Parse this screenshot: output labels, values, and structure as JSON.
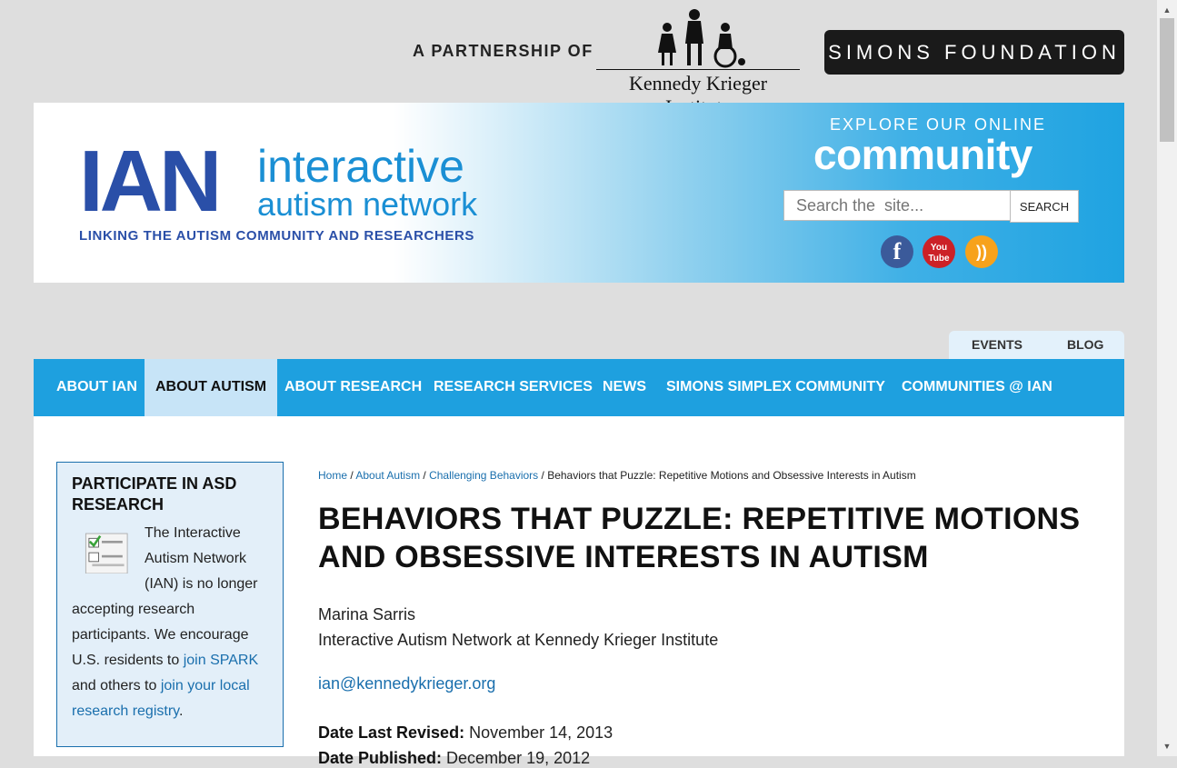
{
  "partners": {
    "label": "A PARTNERSHIP OF",
    "kki_name": "Kennedy Krieger Institute",
    "simons_name": "SIMONS FOUNDATION"
  },
  "header": {
    "logo_letters": "IAN",
    "logo_line1": "interactive",
    "logo_line2": "autism network",
    "tagline": "LINKING THE AUTISM COMMUNITY AND RESEARCHERS",
    "explore_small": "EXPLORE OUR ONLINE",
    "explore_big": "community",
    "search_placeholder": "Search the  site...",
    "search_button": "SEARCH",
    "social": [
      "facebook-icon",
      "youtube-icon",
      "rss-icon"
    ]
  },
  "subtabs": {
    "events": "EVENTS",
    "blog": "BLOG"
  },
  "nav": {
    "items": [
      "ABOUT IAN",
      "ABOUT AUTISM",
      "ABOUT RESEARCH",
      "RESEARCH SERVICES",
      "NEWS",
      "SIMONS SIMPLEX COMMUNITY",
      "COMMUNITIES @ IAN"
    ],
    "active": "ABOUT AUTISM"
  },
  "sidebar": {
    "title": "PARTICIPATE IN ASD RESEARCH",
    "text1": "The Interactive Autism Network (IAN) is no longer accepting research participants. We encourage U.S. residents to ",
    "link1": "join SPARK",
    "text2": " and others to ",
    "link2": "join your local research registry",
    "text3": "."
  },
  "breadcrumb": {
    "home": "Home",
    "about_autism": "About Autism",
    "challenging": "Challenging Behaviors",
    "current": "Behaviors that Puzzle: Repetitive Motions and Obsessive Interests in Autism",
    "sep": " / "
  },
  "article": {
    "title": "BEHAVIORS THAT PUZZLE: REPETITIVE MOTIONS AND OBSESSIVE INTERESTS IN AUTISM",
    "author": "Marina Sarris",
    "affiliation": "Interactive Autism Network at Kennedy Krieger Institute",
    "email": "ian@kennedykrieger.org",
    "revised_label": "Date Last Revised:",
    "revised_value": "November 14, 2013",
    "published_label": "Date Published:",
    "published_value": "December 19, 2012"
  }
}
